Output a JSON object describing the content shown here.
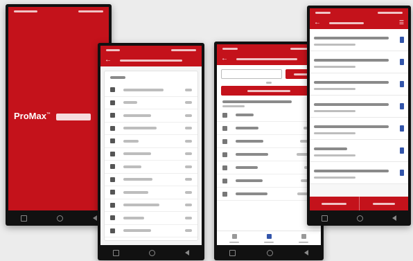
{
  "phone1": {
    "brand_title": "ProMax",
    "brand_trademark": "™"
  },
  "phone2": {
    "app_bar_title": "",
    "card_title": "",
    "rows": [
      {
        "label": "",
        "value": ""
      },
      {
        "label": "",
        "value": ""
      },
      {
        "label": "",
        "value": ""
      },
      {
        "label": "",
        "value": ""
      },
      {
        "label": "",
        "value": ""
      },
      {
        "label": "",
        "value": ""
      },
      {
        "label": "",
        "value": ""
      },
      {
        "label": "",
        "value": ""
      },
      {
        "label": "",
        "value": ""
      },
      {
        "label": "",
        "value": ""
      },
      {
        "label": "",
        "value": ""
      },
      {
        "label": "",
        "value": ""
      }
    ]
  },
  "phone3": {
    "app_bar_title": "",
    "search": {
      "value": "",
      "placeholder": ""
    },
    "search_button_label": "",
    "or_label": "",
    "select_button_label": "",
    "list_title": "",
    "list_subtitle": "",
    "items": [
      {
        "label": "",
        "value": ""
      },
      {
        "label": "",
        "value": ""
      },
      {
        "label": "",
        "value": ""
      },
      {
        "label": "",
        "value": ""
      },
      {
        "label": "",
        "value": ""
      },
      {
        "label": "",
        "value": ""
      },
      {
        "label": "",
        "value": ""
      }
    ],
    "bottom_tabs": [
      {
        "label": ""
      },
      {
        "label": ""
      },
      {
        "label": ""
      }
    ]
  },
  "phone4": {
    "app_bar_title": "",
    "list": [
      {
        "title": "",
        "subtitle": ""
      },
      {
        "title": "",
        "subtitle": ""
      },
      {
        "title": "",
        "subtitle": ""
      },
      {
        "title": "",
        "subtitle": ""
      },
      {
        "title": "",
        "subtitle": ""
      },
      {
        "title": "",
        "subtitle": ""
      },
      {
        "title": "",
        "subtitle": ""
      }
    ],
    "bottom_buttons": [
      {
        "label": ""
      },
      {
        "label": ""
      }
    ]
  },
  "colors": {
    "brand_red": "#c4121b",
    "icon_blue": "#3355aa",
    "background": "#ececec"
  },
  "icons": [
    "back-arrow-icon",
    "home-icon",
    "recent-apps-icon",
    "document-icon",
    "menu-icon"
  ]
}
